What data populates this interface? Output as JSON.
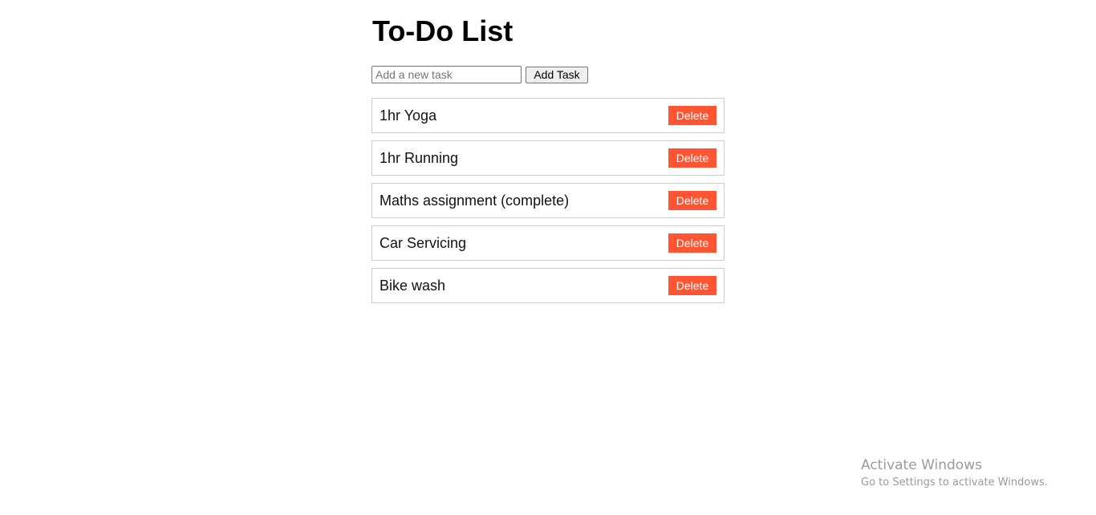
{
  "page": {
    "title": "To-Do List"
  },
  "new_task": {
    "placeholder": "Add a new task",
    "value": "",
    "add_label": "Add Task"
  },
  "tasks": [
    {
      "text": "1hr Yoga",
      "delete_label": "Delete"
    },
    {
      "text": "1hr Running",
      "delete_label": "Delete"
    },
    {
      "text": "Maths assignment (complete)",
      "delete_label": "Delete"
    },
    {
      "text": "Car Servicing",
      "delete_label": "Delete"
    },
    {
      "text": "Bike wash",
      "delete_label": "Delete"
    }
  ],
  "watermark": {
    "title": "Activate Windows",
    "subtitle": "Go to Settings to activate Windows."
  },
  "colors": {
    "delete_button": "#ff5533",
    "delete_text": "#ffffff",
    "item_border": "#cccccc",
    "watermark_text": "#9a9a9a"
  }
}
